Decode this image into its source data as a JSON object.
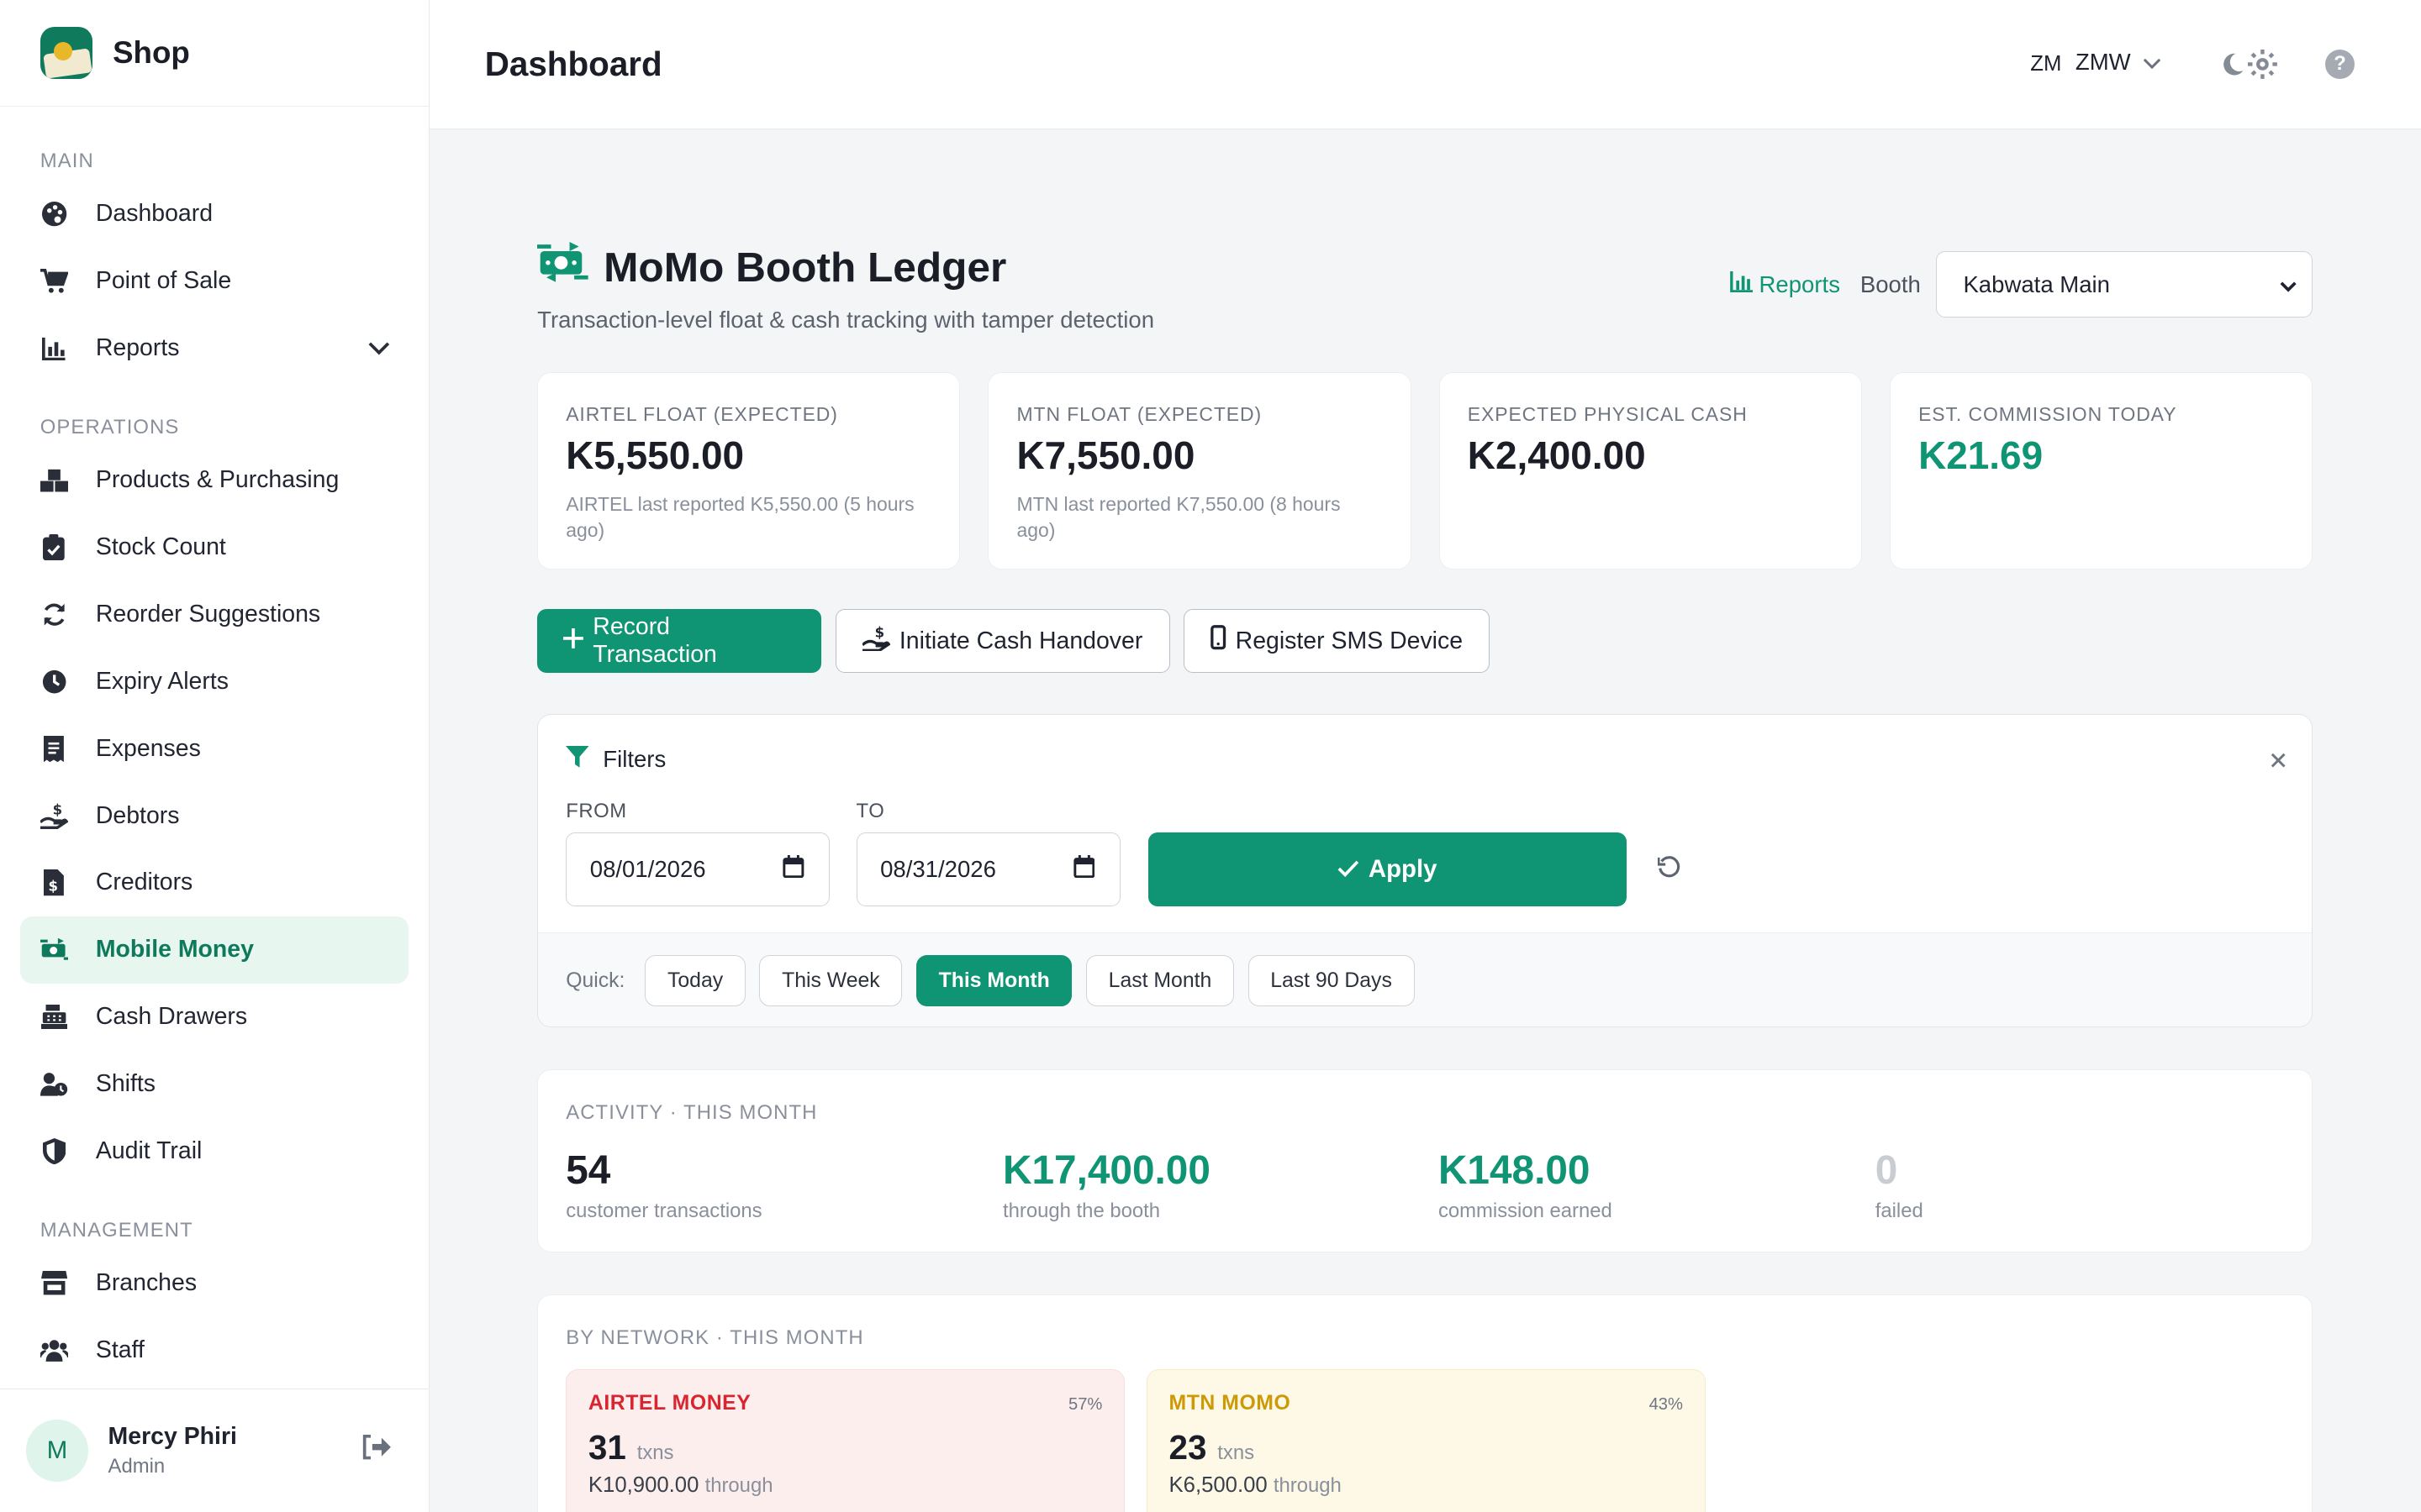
{
  "brand": {
    "name": "Shop"
  },
  "sidebar": {
    "sections": [
      {
        "title": "MAIN",
        "items": [
          {
            "label": "Dashboard",
            "icon": "palette-icon"
          },
          {
            "label": "Point of Sale",
            "icon": "cart-icon"
          },
          {
            "label": "Reports",
            "icon": "chart-icon",
            "expandable": true
          }
        ]
      },
      {
        "title": "OPERATIONS",
        "items": [
          {
            "label": "Products & Purchasing",
            "icon": "boxes-icon"
          },
          {
            "label": "Stock Count",
            "icon": "clipboard-check-icon"
          },
          {
            "label": "Reorder Suggestions",
            "icon": "refresh-icon"
          },
          {
            "label": "Expiry Alerts",
            "icon": "clock-icon"
          },
          {
            "label": "Expenses",
            "icon": "receipt-icon"
          },
          {
            "label": "Debtors",
            "icon": "hand-dollar-icon"
          },
          {
            "label": "Creditors",
            "icon": "invoice-dollar-icon"
          },
          {
            "label": "Mobile Money",
            "icon": "money-transfer-icon",
            "active": true
          },
          {
            "label": "Cash Drawers",
            "icon": "cash-register-icon"
          },
          {
            "label": "Shifts",
            "icon": "user-clock-icon"
          },
          {
            "label": "Audit Trail",
            "icon": "shield-icon"
          }
        ]
      },
      {
        "title": "MANAGEMENT",
        "items": [
          {
            "label": "Branches",
            "icon": "store-icon"
          },
          {
            "label": "Staff",
            "icon": "users-icon"
          }
        ]
      }
    ],
    "user": {
      "initial": "M",
      "name": "Mercy Phiri",
      "role": "Admin"
    }
  },
  "header": {
    "title": "Dashboard",
    "currency_flag": "ZM",
    "currency_code": "ZMW"
  },
  "ledger": {
    "title": "MoMo Booth Ledger",
    "subtitle": "Transaction-level float & cash tracking with tamper detection",
    "reports_link": "Reports",
    "booth_label": "Booth",
    "booth_value": "Kabwata Main"
  },
  "cards": [
    {
      "label": "AIRTEL FLOAT (EXPECTED)",
      "value": "K5,550.00",
      "note": "AIRTEL last reported K5,550.00 (5 hours ago)",
      "green": false
    },
    {
      "label": "MTN FLOAT (EXPECTED)",
      "value": "K7,550.00",
      "note": "MTN last reported K7,550.00 (8 hours ago)",
      "green": false
    },
    {
      "label": "EXPECTED PHYSICAL CASH",
      "value": "K2,400.00",
      "note": "",
      "green": false
    },
    {
      "label": "EST. COMMISSION TODAY",
      "value": "K21.69",
      "note": "",
      "green": true
    }
  ],
  "actions": {
    "record": "Record Transaction",
    "handover": "Initiate Cash Handover",
    "register": "Register SMS Device"
  },
  "filters": {
    "title": "Filters",
    "from_label": "FROM",
    "from_value": "08/01/2026",
    "to_label": "TO",
    "to_value": "08/31/2026",
    "apply": "Apply",
    "quick_label": "Quick:",
    "quick": [
      {
        "label": "Today",
        "active": false
      },
      {
        "label": "This Week",
        "active": false
      },
      {
        "label": "This Month",
        "active": true
      },
      {
        "label": "Last Month",
        "active": false
      },
      {
        "label": "Last 90 Days",
        "active": false
      }
    ]
  },
  "activity": {
    "label": "ACTIVITY · THIS MONTH",
    "stats": [
      {
        "value": "54",
        "caption": "customer transactions",
        "tone": "dark"
      },
      {
        "value": "K17,400.00",
        "caption": "through the booth",
        "tone": "green"
      },
      {
        "value": "K148.00",
        "caption": "commission earned",
        "tone": "green"
      },
      {
        "value": "0",
        "caption": "failed",
        "tone": "grey"
      }
    ]
  },
  "network": {
    "label": "BY NETWORK · THIS MONTH",
    "items": [
      {
        "name": "AIRTEL MONEY",
        "pct": "57%",
        "count": "31",
        "unit": "txns",
        "amount": "K10,900.00",
        "through": "through"
      },
      {
        "name": "MTN MOMO",
        "pct": "43%",
        "count": "23",
        "unit": "txns",
        "amount": "K6,500.00",
        "through": "through"
      }
    ]
  },
  "colors": {
    "accent": "#0f9474",
    "airtel": "#d8252f",
    "mtn": "#cc9a07"
  }
}
